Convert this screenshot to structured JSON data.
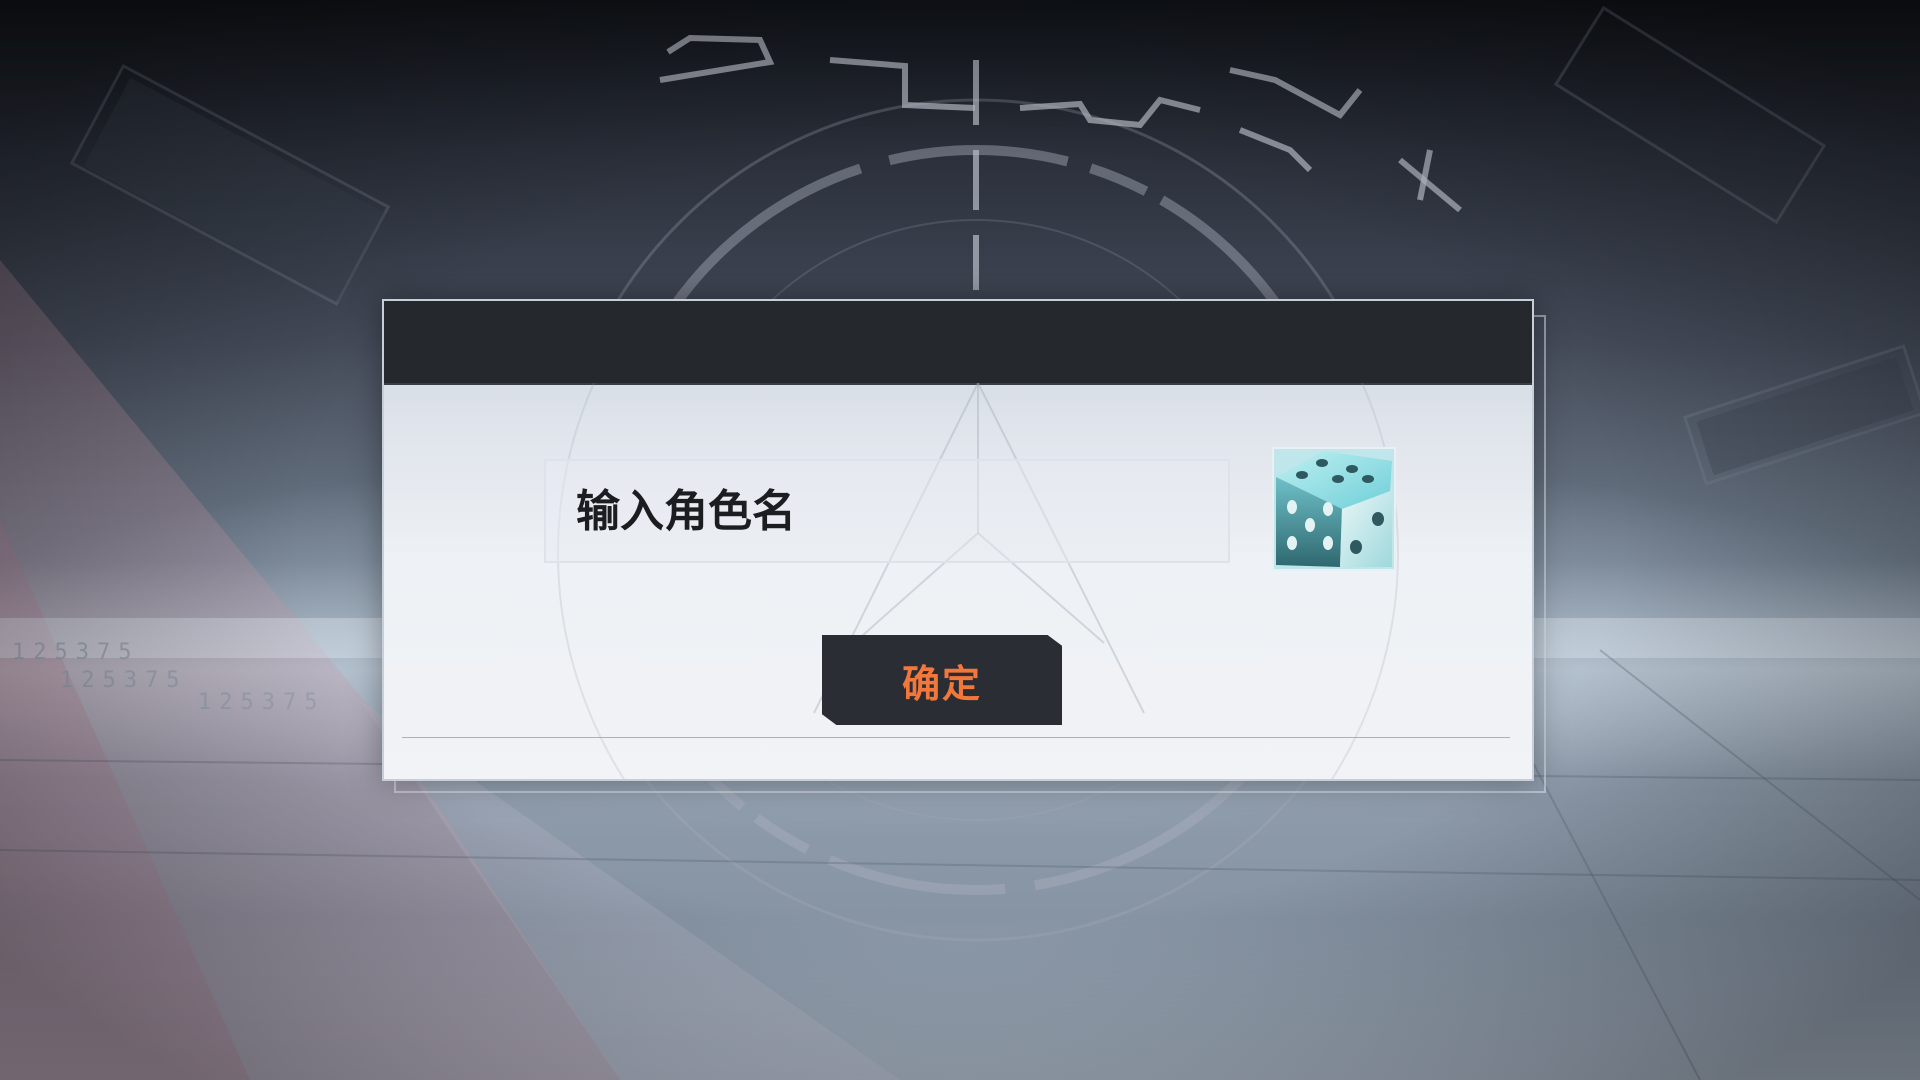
{
  "background": {
    "serial_numbers": [
      "125375",
      "125375",
      "125375"
    ]
  },
  "dialog": {
    "header_title": "",
    "name_input": {
      "value": "",
      "placeholder": "输入角色名"
    },
    "dice_icon": "dice-icon",
    "confirm_label": "确定"
  },
  "colors": {
    "header": "#25282d",
    "button_bg": "#2a2d33",
    "button_text": "#f2773a",
    "dice_face": "#7fd8e0"
  }
}
